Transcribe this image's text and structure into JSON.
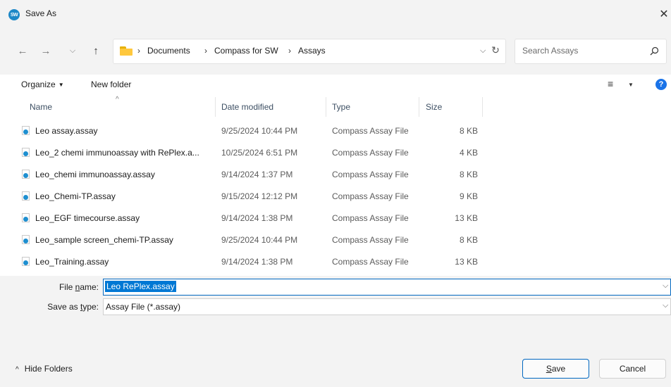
{
  "window": {
    "title": "Save As",
    "app_icon_text": "SW",
    "close_glyph": "✕"
  },
  "nav": {
    "back_glyph": "←",
    "forward_glyph": "→",
    "recent_glyph": "⌵",
    "up_glyph": "↑",
    "breadcrumbs": [
      "Documents",
      "Compass for SW",
      "Assays"
    ],
    "separator": "›",
    "address_dropdown_glyph": "⌵",
    "refresh_glyph": "↻"
  },
  "search": {
    "placeholder": "Search Assays",
    "icon": "search-icon"
  },
  "toolbar": {
    "organize_label": "Organize",
    "organize_caret": "▼",
    "new_folder_label": "New folder",
    "view_glyph": "≡",
    "view_caret": "▼",
    "help_glyph": "?"
  },
  "file_list": {
    "sort_indicator": "^",
    "columns": {
      "name": "Name",
      "date": "Date modified",
      "type": "Type",
      "size": "Size"
    },
    "rows": [
      {
        "name": "Leo assay.assay",
        "date": "9/25/2024 10:44 PM",
        "type": "Compass Assay File",
        "size": "8 KB"
      },
      {
        "name": "Leo_2 chemi immunoassay with RePlex.a...",
        "date": "10/25/2024 6:51 PM",
        "type": "Compass Assay File",
        "size": "4 KB"
      },
      {
        "name": "Leo_chemi immunoassay.assay",
        "date": "9/14/2024 1:37 PM",
        "type": "Compass Assay File",
        "size": "8 KB"
      },
      {
        "name": "Leo_Chemi-TP.assay",
        "date": "9/15/2024 12:12 PM",
        "type": "Compass Assay File",
        "size": "9 KB"
      },
      {
        "name": "Leo_EGF timecourse.assay",
        "date": "9/14/2024 1:38 PM",
        "type": "Compass Assay File",
        "size": "13 KB"
      },
      {
        "name": "Leo_sample screen_chemi-TP.assay",
        "date": "9/25/2024 10:44 PM",
        "type": "Compass Assay File",
        "size": "8 KB"
      },
      {
        "name": "Leo_Training.assay",
        "date": "9/14/2024 1:38 PM",
        "type": "Compass Assay File",
        "size": "13 KB"
      }
    ]
  },
  "form": {
    "file_name_label_prefix": "File ",
    "file_name_label_accel": "n",
    "file_name_label_suffix": "ame:",
    "file_name_value": "Leo RePlex.assay",
    "save_type_label_prefix": "Save as ",
    "save_type_label_accel": "t",
    "save_type_label_suffix": "ype:",
    "save_type_value": "Assay File (*.assay)",
    "dropdown_glyph": "⌵"
  },
  "footer": {
    "hide_folders_glyph": "^",
    "hide_folders_label": "Hide Folders",
    "save_label_accel": "S",
    "save_label_rest": "ave",
    "cancel_label": "Cancel"
  },
  "colors": {
    "accent": "#0067c0",
    "selection": "#0078d4",
    "chrome": "#f3f3f3",
    "folder": "#ffc83d"
  }
}
